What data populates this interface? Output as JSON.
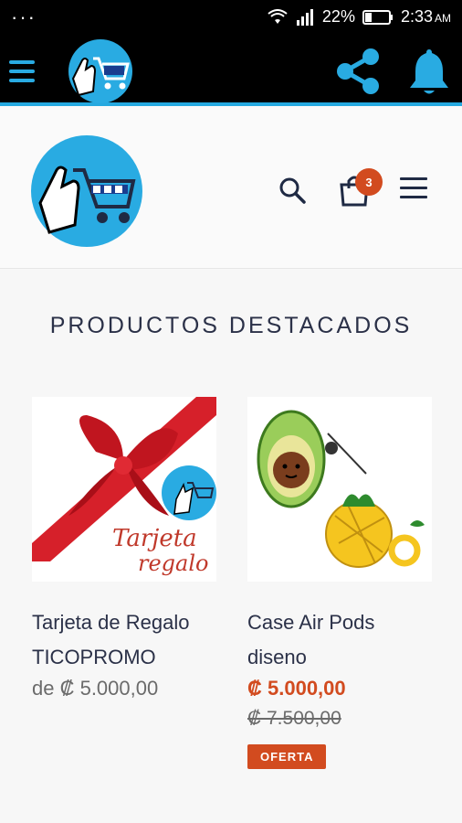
{
  "status_bar": {
    "signal_label": "",
    "battery": "22%",
    "time": "2:33",
    "ampm": "AM"
  },
  "app_bar": {
    "menu_icon": "hamburger-icon",
    "share_icon": "share-icon",
    "bell_icon": "bell-icon"
  },
  "store": {
    "search_icon": "search-icon",
    "cart_icon": "shopping-bag-icon",
    "cart_count": "3",
    "menu_icon": "hamburger-icon"
  },
  "section": {
    "title": "PRODUCTOS DESTACADOS"
  },
  "products": [
    {
      "title_line1": "Tarjeta de Regalo",
      "title_line2": "TICOPROMO",
      "price": "de ₡ 5.000,00",
      "image_text_line1": "Tarjeta",
      "image_text_line2": "regalo"
    },
    {
      "title_line1": "Case Air Pods",
      "title_line2": "diseno",
      "sale_price": "₡ 5.000,00",
      "old_price": "₡ 7.500,00",
      "tag": "OFERTA"
    }
  ],
  "colors": {
    "accent": "#29abe2",
    "sale": "#d24b1f",
    "text": "#2b3148"
  }
}
